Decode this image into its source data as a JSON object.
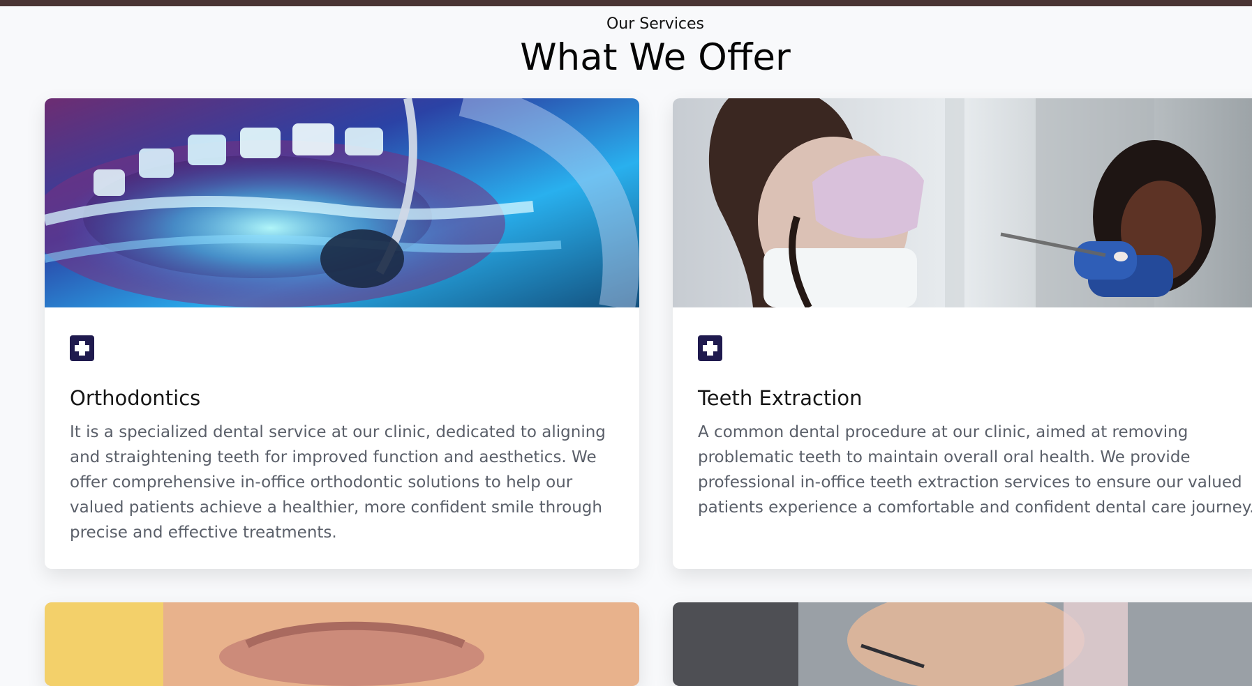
{
  "header": {
    "eyebrow": "Our Services",
    "title": "What We Offer"
  },
  "services": [
    {
      "title": "Orthodontics",
      "description": "It is a specialized dental service at our clinic, dedicated to aligning and straightening teeth for improved function and aesthetics. We offer comprehensive in-office orthodontic solutions to help our valued patients achieve a healthier, more confident smile through precise and effective treatments.",
      "icon": "medical-cross-icon"
    },
    {
      "title": "Teeth Extraction",
      "description": "A common dental procedure at our clinic, aimed at removing problematic teeth to maintain overall oral health. We provide professional in-office teeth extraction services to ensure our valued patients experience a comfortable and confident dental care journey.",
      "icon": "medical-cross-icon"
    }
  ],
  "colors": {
    "top_bar": "#4a3434",
    "icon_background": "#1f1a4e",
    "page_background": "#f8f9fb"
  }
}
